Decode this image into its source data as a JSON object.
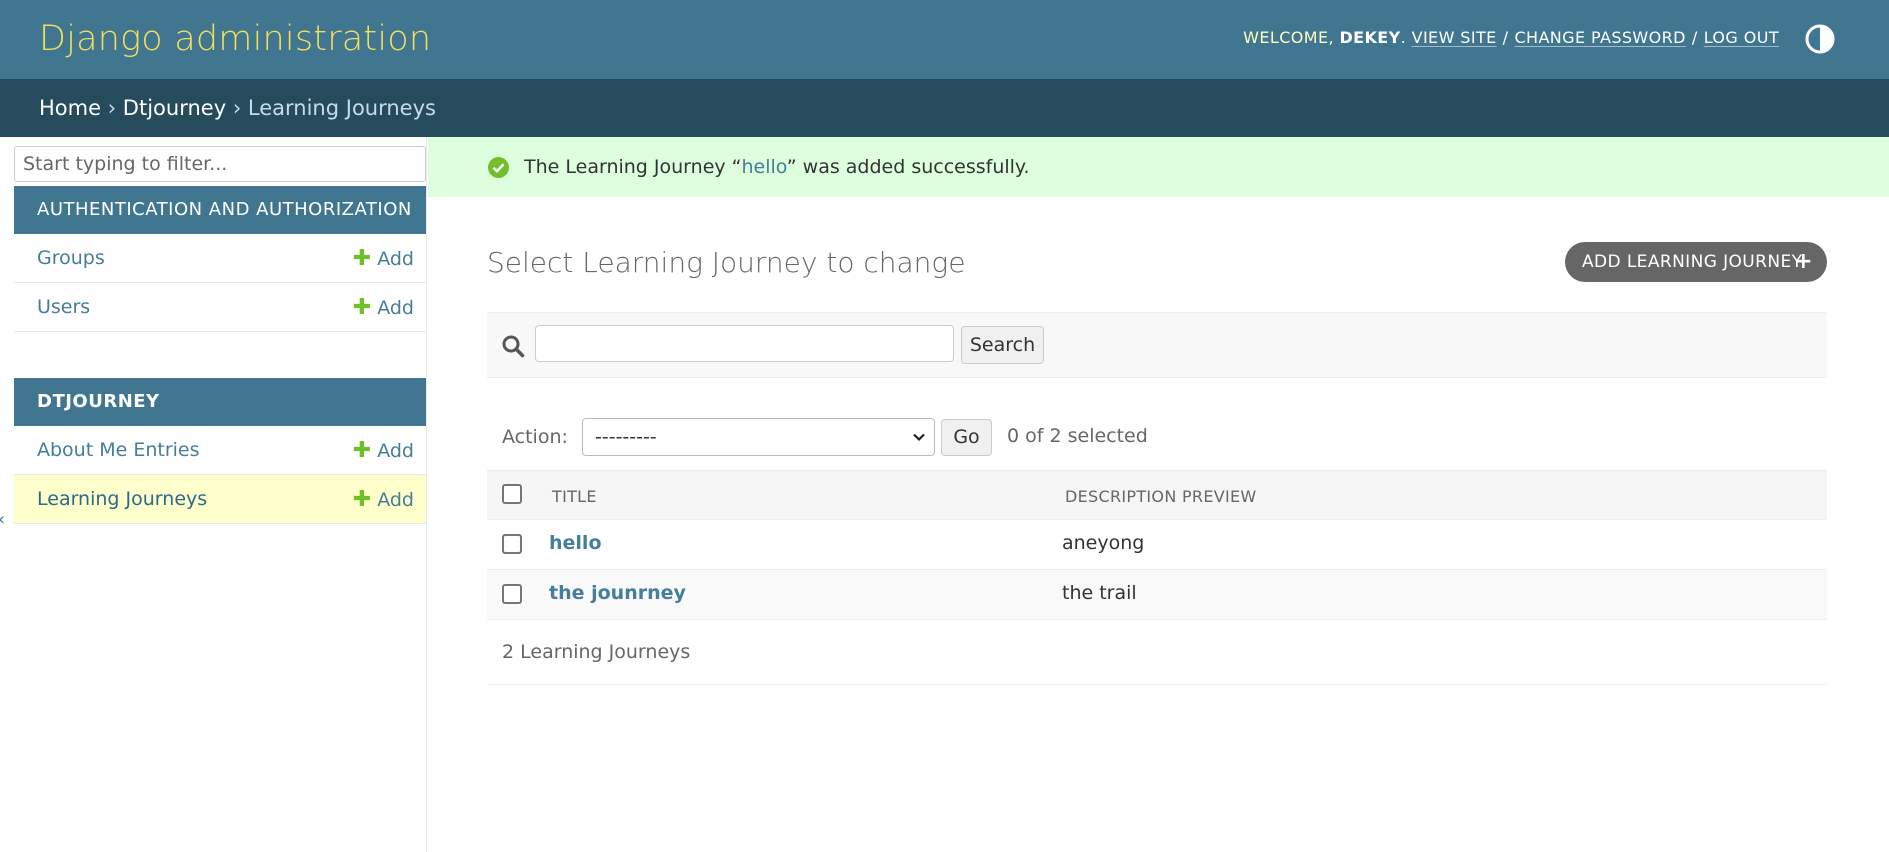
{
  "header": {
    "brand": "Django administration",
    "welcome": "WELCOME,",
    "username": "DEKEY",
    "view_site": "VIEW SITE",
    "change_password": "CHANGE PASSWORD",
    "log_out": "LOG OUT",
    "sep": "/",
    "theme_icon": "contrast-toggle-icon"
  },
  "breadcrumbs": {
    "home": "Home",
    "app": "Dtjourney",
    "current": "Learning Journeys",
    "sep": "›"
  },
  "sidebar": {
    "filter_placeholder": "Start typing to filter...",
    "modules": [
      {
        "caption": "AUTHENTICATION AND AUTHORIZATION",
        "models": [
          {
            "name": "Groups",
            "add": "Add"
          },
          {
            "name": "Users",
            "add": "Add"
          }
        ]
      },
      {
        "caption": "DTJOURNEY",
        "models": [
          {
            "name": "About Me Entries",
            "add": "Add"
          },
          {
            "name": "Learning Journeys",
            "add": "Add"
          }
        ]
      }
    ]
  },
  "message": {
    "before": "The Learning Journey “",
    "object": "hello",
    "after": "” was added successfully."
  },
  "content": {
    "title": "Select Learning Journey to change",
    "add_button": "ADD LEARNING JOURNEY",
    "add_icon": "+",
    "search_button": "Search",
    "action_label": "Action:",
    "action_selected": "---------",
    "go_button": "Go",
    "selected_count": "0 of 2 selected",
    "columns": [
      "TITLE",
      "DESCRIPTION PREVIEW"
    ],
    "rows": [
      {
        "title": "hello",
        "description": "aneyong"
      },
      {
        "title": "the jounrney",
        "description": "the trail"
      }
    ],
    "paginator": "2 Learning Journeys"
  },
  "colors": {
    "header_bg": "#417690",
    "breadcrumbs_bg": "#264b5d",
    "brand": "#f5dd5d",
    "link": "#447e9b",
    "success_bg": "#ddffdd",
    "add_green": "#70bf2b"
  }
}
